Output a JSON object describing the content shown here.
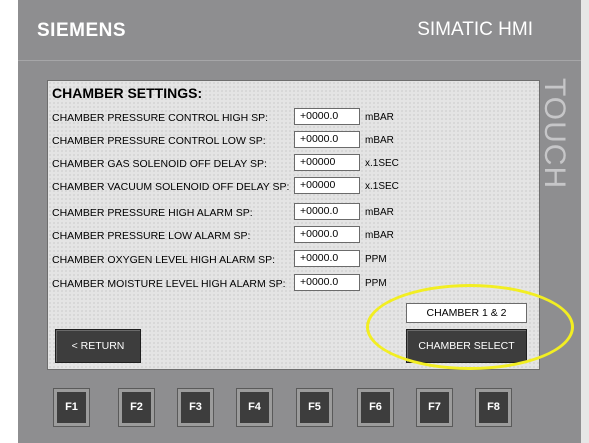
{
  "header": {
    "brand": "SIEMENS",
    "model": "SIMATIC HMI"
  },
  "bezel": {
    "touch_label": "TOUCH"
  },
  "screen": {
    "title": "CHAMBER SETTINGS:",
    "rows": [
      {
        "label": "CHAMBER PRESSURE CONTROL HIGH SP:",
        "value": "+0000.0",
        "unit": "mBAR"
      },
      {
        "label": "CHAMBER PRESSURE CONTROL LOW SP:",
        "value": "+0000.0",
        "unit": "mBAR"
      },
      {
        "label": "CHAMBER GAS SOLENOID OFF DELAY SP:",
        "value": "+00000",
        "unit": "x.1SEC"
      },
      {
        "label": "CHAMBER VACUUM SOLENOID OFF DELAY SP:",
        "value": "+00000",
        "unit": "x.1SEC"
      },
      {
        "label": "CHAMBER PRESSURE HIGH ALARM SP:",
        "value": "+0000.0",
        "unit": "mBAR"
      },
      {
        "label": "CHAMBER PRESSURE LOW ALARM SP:",
        "value": "+0000.0",
        "unit": "mBAR"
      },
      {
        "label": "CHAMBER OXYGEN LEVEL HIGH ALARM SP:",
        "value": "+0000.0",
        "unit": "PPM"
      },
      {
        "label": "CHAMBER MOISTURE LEVEL HIGH ALARM SP:",
        "value": "+0000.0",
        "unit": "PPM"
      }
    ],
    "chamber_display": "CHAMBER 1 & 2",
    "return_label": "< RETURN",
    "chamber_select_label": "CHAMBER SELECT"
  },
  "function_keys": [
    "F1",
    "F2",
    "F3",
    "F4",
    "F5",
    "F6",
    "F7",
    "F8"
  ],
  "colors": {
    "bezel": "#8e8e90",
    "screen_bg": "#e4e4e4",
    "button_dark": "#3d3d3d",
    "highlight": "#f2ee22"
  }
}
